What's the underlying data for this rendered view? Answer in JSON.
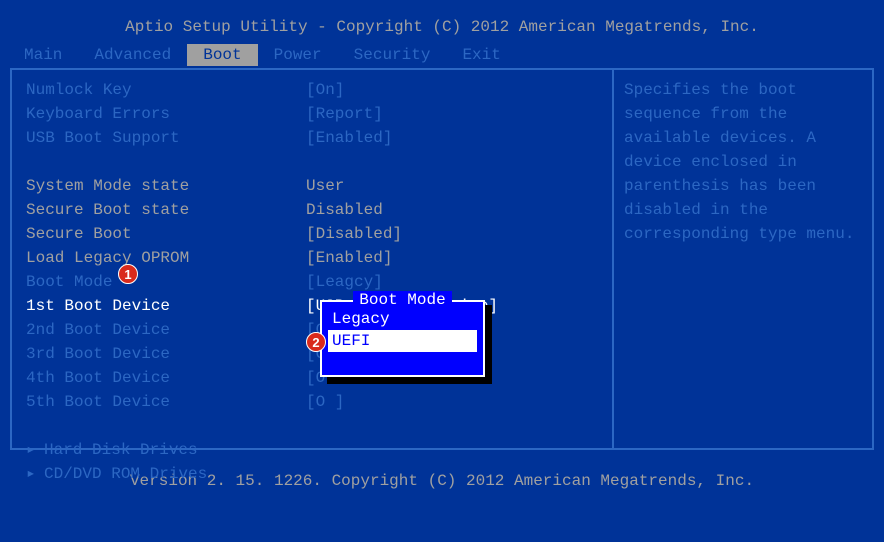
{
  "header": "Aptio Setup Utility - Copyright (C) 2012 American Megatrends, Inc.",
  "tabs": [
    "Main",
    "Advanced",
    "Boot",
    "Power",
    "Security",
    "Exit"
  ],
  "active_tab": "Boot",
  "rows": [
    {
      "label": "Numlock Key",
      "value": "[On]",
      "style": "blue"
    },
    {
      "label": "Keyboard Errors",
      "value": "[Report]",
      "style": "blue"
    },
    {
      "label": "USB Boot Support",
      "value": "[Enabled]",
      "style": "blue"
    },
    {
      "spacer": true
    },
    {
      "label": "System Mode state",
      "value": "User",
      "style": "gray"
    },
    {
      "label": "Secure Boot state",
      "value": "Disabled",
      "style": "gray"
    },
    {
      "label": "Secure Boot",
      "value": "[Disabled]",
      "style": "gray"
    },
    {
      "label": "Load Legacy OPROM",
      "value": "[Enabled]",
      "style": "gray"
    },
    {
      "label": "Boot Mode",
      "value": "[Leagcy]",
      "style": "blue"
    },
    {
      "label": "1st Boot Device",
      "value": "[USB Storage Device]",
      "style": "selected"
    },
    {
      "label": "2nd Boot Device",
      "value": "[O              ices: P...]",
      "style": "blue"
    },
    {
      "label": "3rd Boot Device",
      "value": "[O               es: W...]",
      "style": "blue"
    },
    {
      "label": "4th Boot Device",
      "value": "[O",
      "style": "blue"
    },
    {
      "label": "5th Boot Device",
      "value": "[O               ]",
      "style": "blue"
    }
  ],
  "submenus": [
    "Hard Disk Drives",
    "CD/DVD ROM Drives"
  ],
  "help_text": "Specifies the boot sequence from the available devices. A device enclosed in parenthesis has been disabled in the corresponding type menu.",
  "popup": {
    "title": "Boot Mode",
    "items": [
      "Legacy",
      "UEFI"
    ],
    "selected": "UEFI"
  },
  "footer": "Version 2. 15. 1226. Copyright (C) 2012 American Megatrends, Inc.",
  "badges": {
    "b1": "1",
    "b2": "2"
  }
}
